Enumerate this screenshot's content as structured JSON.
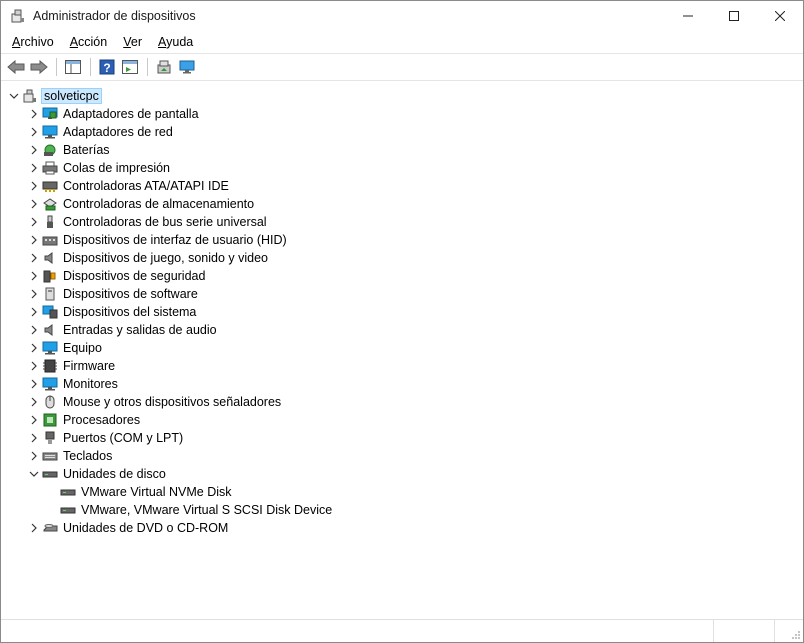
{
  "window": {
    "title": "Administrador de dispositivos"
  },
  "menu": [
    {
      "key": "A",
      "rest": "rchivo"
    },
    {
      "key": "A",
      "rest": "cción"
    },
    {
      "key": "V",
      "rest": "er"
    },
    {
      "key": "A",
      "rest": "yuda"
    }
  ],
  "toolbar": {
    "icons": [
      "back-icon",
      "forward-icon",
      "show-hide-console-tree-icon",
      "help-icon",
      "action-pane-icon",
      "update-driver-icon",
      "scan-hardware-icon"
    ]
  },
  "tree": {
    "root": "solveticpc",
    "categories": [
      "Adaptadores de pantalla",
      "Adaptadores de red",
      "Baterías",
      "Colas de impresión",
      "Controladoras ATA/ATAPI IDE",
      "Controladoras de almacenamiento",
      "Controladoras de bus serie universal",
      "Dispositivos de interfaz de usuario (HID)",
      "Dispositivos de juego, sonido y video",
      "Dispositivos de seguridad",
      "Dispositivos de software",
      "Dispositivos del sistema",
      "Entradas y salidas de audio",
      "Equipo",
      "Firmware",
      "Monitores",
      "Mouse y otros dispositivos señaladores",
      "Procesadores",
      "Puertos (COM y LPT)",
      "Teclados",
      "Unidades de disco"
    ],
    "disk_children": [
      "VMware Virtual NVMe Disk",
      "VMware, VMware Virtual S SCSI Disk Device"
    ],
    "last_category": "Unidades de DVD o CD-ROM"
  },
  "colors": {
    "selection": "#cce8ff",
    "selection_border": "#99d1ff",
    "accent": "#0078d4"
  }
}
